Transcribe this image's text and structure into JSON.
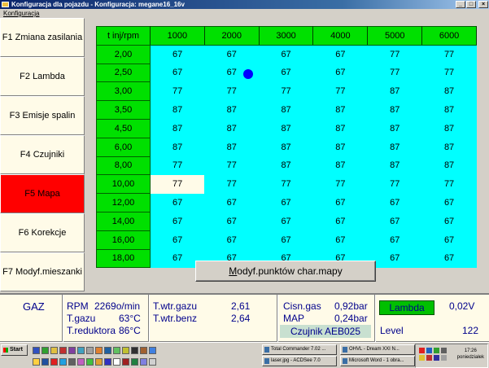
{
  "window": {
    "title": "Konfiguracja dla pojazdu - Konfiguracja: megane16_16v",
    "menu_item": "Konfiguracja"
  },
  "sidebar": {
    "items": [
      {
        "label": "F1 Zmiana zasilania",
        "active": false
      },
      {
        "label": "F2 Lambda",
        "active": false
      },
      {
        "label": "F3 Emisje spalin",
        "active": false
      },
      {
        "label": "F4 Czujniki",
        "active": false
      },
      {
        "label": "F5 Mapa",
        "active": true
      },
      {
        "label": "F6 Korekcje",
        "active": false
      },
      {
        "label": "F7 Modyf.mieszanki",
        "active": false
      }
    ]
  },
  "map": {
    "corner_label": "t inj/rpm",
    "columns": [
      "1000",
      "2000",
      "3000",
      "4000",
      "5000",
      "6000"
    ],
    "rows": [
      {
        "label": "2,00",
        "values": [
          "67",
          "67",
          "67",
          "67",
          "77",
          "77"
        ]
      },
      {
        "label": "2,50",
        "values": [
          "67",
          "67",
          "67",
          "67",
          "77",
          "77"
        ]
      },
      {
        "label": "3,00",
        "values": [
          "77",
          "77",
          "77",
          "77",
          "87",
          "87"
        ]
      },
      {
        "label": "3,50",
        "values": [
          "87",
          "87",
          "87",
          "87",
          "87",
          "87"
        ]
      },
      {
        "label": "4,50",
        "values": [
          "87",
          "87",
          "87",
          "87",
          "87",
          "87"
        ]
      },
      {
        "label": "6,00",
        "values": [
          "87",
          "87",
          "87",
          "87",
          "87",
          "87"
        ]
      },
      {
        "label": "8,00",
        "values": [
          "77",
          "77",
          "87",
          "87",
          "87",
          "87"
        ]
      },
      {
        "label": "10,00",
        "values": [
          "77",
          "77",
          "77",
          "77",
          "77",
          "77"
        ]
      },
      {
        "label": "12,00",
        "values": [
          "67",
          "67",
          "67",
          "67",
          "67",
          "67"
        ]
      },
      {
        "label": "14,00",
        "values": [
          "67",
          "67",
          "67",
          "67",
          "67",
          "67"
        ]
      },
      {
        "label": "16,00",
        "values": [
          "67",
          "67",
          "67",
          "67",
          "67",
          "67"
        ]
      },
      {
        "label": "18,00",
        "values": [
          "67",
          "67",
          "67",
          "67",
          "67",
          "67"
        ]
      }
    ],
    "selected_cell": {
      "row": 7,
      "col": 0
    },
    "cursor_marker": {
      "row": 1,
      "col": 1
    },
    "colors": {
      "header": "#00e000",
      "cell": "#00ffff",
      "selected": "#fffbe8",
      "marker": "#0000ff"
    }
  },
  "modify_button": {
    "label_underlined": "M",
    "label_rest": "odyf.punktów char.mapy"
  },
  "status": {
    "mode": "GAZ",
    "rpm_label": "RPM",
    "rpm_value": "2269o/min",
    "tgazu_label": "T.gazu",
    "tgazu_value": "63°C",
    "tred_label": "T.reduktora",
    "tred_value": "86°C",
    "twtr_gazu_label": "T.wtr.gazu",
    "twtr_gazu_value": "2,61",
    "twtr_benz_label": "T.wtr.benz",
    "twtr_benz_value": "2,64",
    "cisn_label": "Cisn.gas",
    "cisn_value": "0,92bar",
    "map_label": "MAP",
    "map_value": "0,24bar",
    "sensor": "Czujnik AEB025",
    "lambda_label": "Lambda",
    "lambda_value": "0,02V",
    "level_label": "Level",
    "level_value": "122"
  },
  "taskbar": {
    "start": "Start",
    "tasks": [
      {
        "label": "Total Commander 7.02 ...",
        "pressed": false
      },
      {
        "label": "OHVL - Dream XXI N...",
        "pressed": false
      },
      {
        "label": "laser.jpg - ACDSee 7.0",
        "pressed": false
      },
      {
        "label": "Microsoft Word - 1 obra...",
        "pressed": false
      }
    ],
    "clock_time": "17:26",
    "clock_day": "poniedziałek"
  }
}
